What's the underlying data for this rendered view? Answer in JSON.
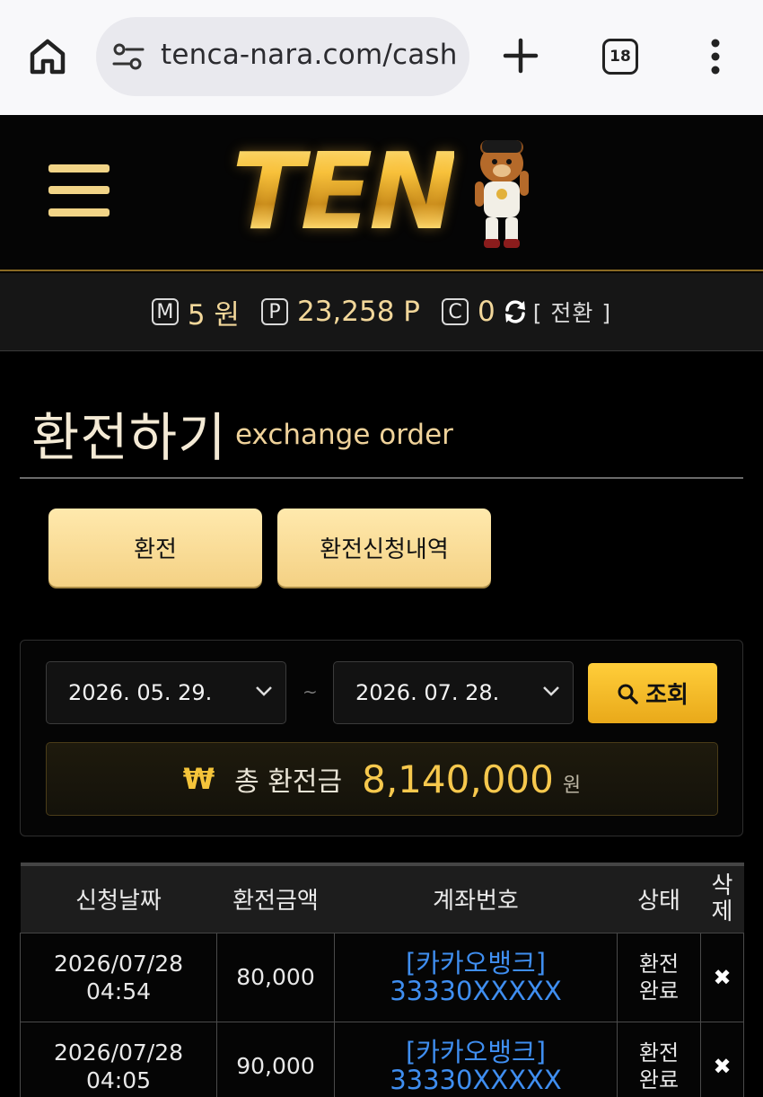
{
  "browser": {
    "url": "tenca-nara.com/cash",
    "tab_count": "18"
  },
  "site": {
    "logo_text": "TEN"
  },
  "balance": {
    "money_badge": "M",
    "money_value": "5 원",
    "point_badge": "P",
    "point_value": "23,258 P",
    "coin_badge": "C",
    "coin_value": "0",
    "swap_label": "[ 전환 ]"
  },
  "page": {
    "title": "환전하기",
    "subtitle": "exchange order"
  },
  "tabs": [
    {
      "label": "환전"
    },
    {
      "label": "환전신청내역"
    }
  ],
  "filter": {
    "date_from": "2026. 05. 29.",
    "separator": "~",
    "date_to": "2026. 07. 28.",
    "search_label": "조회"
  },
  "total": {
    "symbol": "₩",
    "label": "총 환전금",
    "value": "8,140,000",
    "unit": "원"
  },
  "table": {
    "headers": [
      "신청날짜",
      "환전금액",
      "계좌번호",
      "상태",
      "삭제"
    ],
    "rows": [
      {
        "date": "2026/07/28",
        "time": "04:54",
        "amount": "80,000",
        "bank": "[카카오뱅크]",
        "account": "33330XXXXX",
        "status_1": "환전",
        "status_2": "완료",
        "delete": "✖"
      },
      {
        "date": "2026/07/28",
        "time": "04:05",
        "amount": "90,000",
        "bank": "[카카오뱅크]",
        "account": "33330XXXXX",
        "status_1": "환전",
        "status_2": "완료",
        "delete": "✖"
      }
    ]
  },
  "colors": {
    "accent_gold": "#f6c84d",
    "button_gold": "#f4d184",
    "account_blue": "#3f8ef0",
    "background": "#000000"
  },
  "icons": {
    "home": "home-icon",
    "site_settings": "tune-icon",
    "new_tab": "plus-icon",
    "tabs": "tab-switcher-icon",
    "menu": "more-vert-icon",
    "hamburger": "hamburger-icon",
    "refresh": "refresh-icon",
    "search": "search-icon",
    "dropdown": "chevron-down-icon",
    "delete": "close-icon"
  }
}
